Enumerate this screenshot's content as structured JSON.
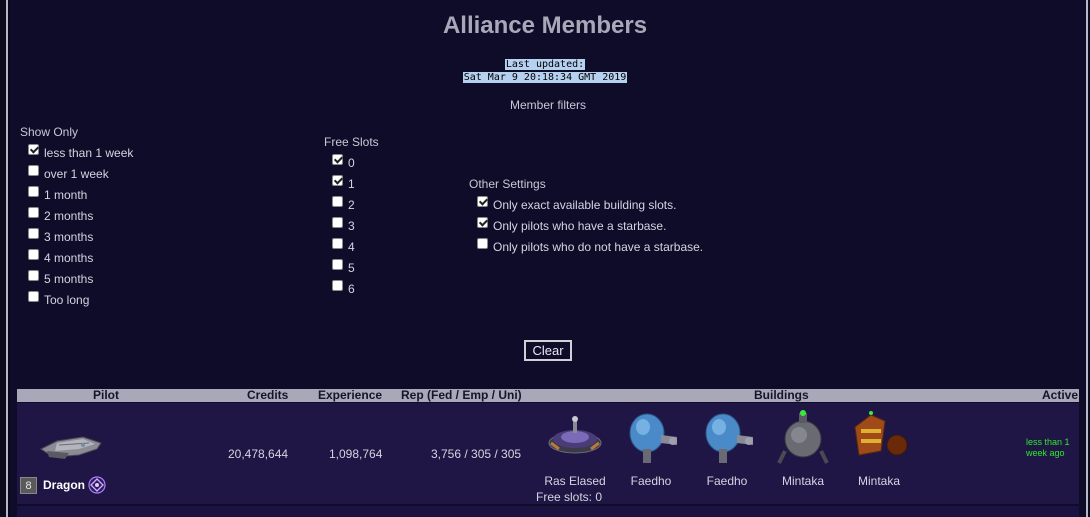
{
  "page": {
    "title": "Alliance Members",
    "last_updated_label": "Last updated:",
    "last_updated_value": "Sat Mar 9 20:18:34 GMT 2019",
    "member_filters": "Member filters"
  },
  "show_only": {
    "title": "Show Only",
    "options": [
      {
        "label": "less than 1 week",
        "checked": true
      },
      {
        "label": "over 1 week",
        "checked": false
      },
      {
        "label": "1 month",
        "checked": false
      },
      {
        "label": "2 months",
        "checked": false
      },
      {
        "label": "3 months",
        "checked": false
      },
      {
        "label": "4 months",
        "checked": false
      },
      {
        "label": "5 months",
        "checked": false
      },
      {
        "label": "Too long",
        "checked": false
      }
    ]
  },
  "free_slots": {
    "title": "Free Slots",
    "options": [
      {
        "label": "0",
        "checked": true
      },
      {
        "label": "1",
        "checked": true
      },
      {
        "label": "2",
        "checked": false
      },
      {
        "label": "3",
        "checked": false
      },
      {
        "label": "4",
        "checked": false
      },
      {
        "label": "5",
        "checked": false
      },
      {
        "label": "6",
        "checked": false
      }
    ]
  },
  "other_settings": {
    "title": "Other Settings",
    "options": [
      {
        "label": "Only exact available building slots.",
        "checked": true
      },
      {
        "label": "Only pilots who have a starbase.",
        "checked": true
      },
      {
        "label": "Only pilots who do not have a starbase.",
        "checked": false
      }
    ]
  },
  "clear_label": "Clear",
  "table": {
    "headers": {
      "pilot": "Pilot",
      "credits": "Credits",
      "experience": "Experience",
      "rep": "Rep (Fed / Emp / Uni)",
      "buildings": "Buildings",
      "active": "Active"
    },
    "rows": [
      {
        "level": "8",
        "name": "Dragon",
        "credits": "20,478,644",
        "experience": "1,098,764",
        "rep": "3,756 / 305 / 305",
        "buildings": [
          "Ras Elased",
          "Faedho",
          "Faedho",
          "Mintaka",
          "Mintaka"
        ],
        "free_slots": "Free slots: 0",
        "active": "less than 1 week ago"
      }
    ]
  },
  "colors": {
    "background": "#0f0c2a",
    "header_bg": "#a8a8b8",
    "row_bg": "#201645",
    "active_text": "#2ee82e",
    "timestamp_highlight": "#b6d0f0"
  }
}
